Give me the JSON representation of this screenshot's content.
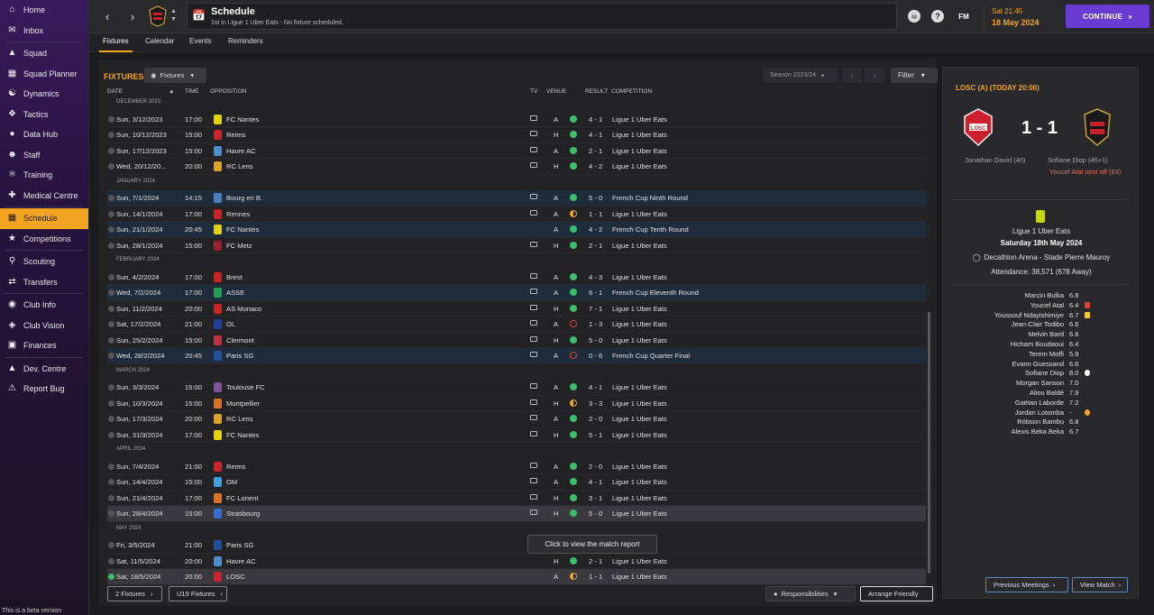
{
  "sidebar": {
    "items": [
      {
        "label": "Home",
        "icon": "home-icon"
      },
      {
        "label": "Inbox",
        "icon": "inbox-icon"
      },
      {
        "label": "Squad",
        "icon": "shirt-icon"
      },
      {
        "label": "Squad Planner",
        "icon": "planner-icon"
      },
      {
        "label": "Dynamics",
        "icon": "dynamics-icon"
      },
      {
        "label": "Tactics",
        "icon": "tactics-icon"
      },
      {
        "label": "Data Hub",
        "icon": "data-hub-icon"
      },
      {
        "label": "Staff",
        "icon": "staff-icon"
      },
      {
        "label": "Training",
        "icon": "training-icon"
      },
      {
        "label": "Medical Centre",
        "icon": "medical-icon"
      },
      {
        "label": "Schedule",
        "icon": "calendar-icon"
      },
      {
        "label": "Competitions",
        "icon": "trophy-icon"
      },
      {
        "label": "Scouting",
        "icon": "scouting-icon"
      },
      {
        "label": "Transfers",
        "icon": "transfers-icon"
      },
      {
        "label": "Club Info",
        "icon": "club-info-icon"
      },
      {
        "label": "Club Vision",
        "icon": "vision-icon"
      },
      {
        "label": "Finances",
        "icon": "finances-icon"
      },
      {
        "label": "Dev. Centre",
        "icon": "dev-centre-icon"
      },
      {
        "label": "Report Bug",
        "icon": "bug-icon"
      }
    ],
    "beta": "This is a beta version"
  },
  "header": {
    "title": "Schedule",
    "subtitle": "1st in Ligue 1 Uber Eats - No fixture scheduled.",
    "time": "Sat 21:45",
    "date": "18 May 2024",
    "continue": "CONTINUE",
    "fm": "FM"
  },
  "tabs": [
    "Fixtures",
    "Calendar",
    "Events",
    "Reminders"
  ],
  "main": {
    "heading": "FIXTURES",
    "fixtures_dd": "Fixtures",
    "season": "Season 2023/24",
    "filter": "Filter",
    "columns": {
      "date": "DATE",
      "time": "TIME",
      "opposition": "OPPOSITION",
      "tv": "TV",
      "venue": "VENUE",
      "result": "RESULT",
      "competition": "COMPETITION"
    },
    "tooltip": "Click to view the match report",
    "footer": {
      "fixtures2": "2 Fixtures",
      "u19": "U19 Fixtures",
      "responsibilities": "Responsibilities",
      "arrange": "Arrange Friendly"
    }
  },
  "rows": [
    {
      "m": "DECEMBER 2023"
    },
    {
      "d": "Sun, 3/12/2023",
      "t": "17:00",
      "o": "FC Nantes",
      "c": "#e6d200",
      "tv": 1,
      "v": "A",
      "r": "w",
      "s": "4 - 1",
      "comp": "Ligue 1 Uber Eats"
    },
    {
      "d": "Sun, 10/12/2023",
      "t": "15:00",
      "o": "Reims",
      "c": "#d0202a",
      "tv": 1,
      "v": "H",
      "r": "w",
      "s": "4 - 1",
      "comp": "Ligue 1 Uber Eats"
    },
    {
      "d": "Sun, 17/12/2023",
      "t": "15:00",
      "o": "Havre AC",
      "c": "#4a90d0",
      "tv": 1,
      "v": "A",
      "r": "w",
      "s": "2 - 1",
      "comp": "Ligue 1 Uber Eats"
    },
    {
      "d": "Wed, 20/12/20...",
      "t": "20:00",
      "o": "RC Lens",
      "c": "#e0a020",
      "tv": 1,
      "v": "H",
      "r": "w",
      "s": "4 - 2",
      "comp": "Ligue 1 Uber Eats"
    },
    {
      "m": "JANUARY 2024"
    },
    {
      "d": "Sun, 7/1/2024",
      "t": "14:15",
      "o": "Bourg en B.",
      "c": "#4a80c0",
      "tv": 1,
      "v": "A",
      "r": "w",
      "s": "5 - 0",
      "comp": "French Cup Ninth Round",
      "cup": 1
    },
    {
      "d": "Sun, 14/1/2024",
      "t": "17:00",
      "o": "Rennes",
      "c": "#d02020",
      "tv": 1,
      "v": "A",
      "r": "d",
      "s": "1 - 1",
      "comp": "Ligue 1 Uber Eats"
    },
    {
      "d": "Sun, 21/1/2024",
      "t": "20:45",
      "o": "FC Nantes",
      "c": "#e6d200",
      "tv": 0,
      "v": "A",
      "r": "w",
      "s": "4 - 2",
      "comp": "French Cup Tenth Round",
      "cup": 1
    },
    {
      "d": "Sun, 28/1/2024",
      "t": "15:00",
      "o": "FC Metz",
      "c": "#a02030",
      "tv": 1,
      "v": "H",
      "r": "w",
      "s": "2 - 1",
      "comp": "Ligue 1 Uber Eats"
    },
    {
      "m": "FEBRUARY 2024"
    },
    {
      "d": "Sun, 4/2/2024",
      "t": "17:00",
      "o": "Brest",
      "c": "#d02020",
      "tv": 1,
      "v": "A",
      "r": "w",
      "s": "4 - 3",
      "comp": "Ligue 1 Uber Eats"
    },
    {
      "d": "Wed, 7/2/2024",
      "t": "17:00",
      "o": "ASSE",
      "c": "#20a050",
      "tv": 1,
      "v": "A",
      "r": "w",
      "s": "6 - 1",
      "comp": "French Cup Eleventh Round",
      "cup": 1
    },
    {
      "d": "Sun, 11/2/2024",
      "t": "20:00",
      "o": "AS Monaco",
      "c": "#d02020",
      "tv": 1,
      "v": "H",
      "r": "w",
      "s": "7 - 1",
      "comp": "Ligue 1 Uber Eats"
    },
    {
      "d": "Sat, 17/2/2024",
      "t": "21:00",
      "o": "OL",
      "c": "#2040a0",
      "tv": 1,
      "v": "A",
      "r": "l",
      "s": "1 - 3",
      "comp": "Ligue 1 Uber Eats"
    },
    {
      "d": "Sun, 25/2/2024",
      "t": "15:00",
      "o": "Clermont",
      "c": "#c03040",
      "tv": 1,
      "v": "H",
      "r": "w",
      "s": "5 - 0",
      "comp": "Ligue 1 Uber Eats"
    },
    {
      "d": "Wed, 28/2/2024",
      "t": "20:45",
      "o": "Paris SG",
      "c": "#2050a0",
      "tv": 1,
      "v": "A",
      "r": "l",
      "s": "0 - 6",
      "comp": "French Cup Quarter Final",
      "cup": 1
    },
    {
      "m": "MARCH 2024"
    },
    {
      "d": "Sun, 3/3/2024",
      "t": "15:00",
      "o": "Toulouse FC",
      "c": "#8050a0",
      "tv": 1,
      "v": "A",
      "r": "w",
      "s": "4 - 1",
      "comp": "Ligue 1 Uber Eats"
    },
    {
      "d": "Sun, 10/3/2024",
      "t": "15:00",
      "o": "Montpellier",
      "c": "#e07020",
      "tv": 1,
      "v": "H",
      "r": "d",
      "s": "3 - 3",
      "comp": "Ligue 1 Uber Eats"
    },
    {
      "d": "Sun, 17/3/2024",
      "t": "20:00",
      "o": "RC Lens",
      "c": "#e0a020",
      "tv": 1,
      "v": "A",
      "r": "w",
      "s": "2 - 0",
      "comp": "Ligue 1 Uber Eats"
    },
    {
      "d": "Sun, 31/3/2024",
      "t": "17:00",
      "o": "FC Nantes",
      "c": "#e6d200",
      "tv": 1,
      "v": "H",
      "r": "w",
      "s": "5 - 1",
      "comp": "Ligue 1 Uber Eats"
    },
    {
      "m": "APRIL 2024"
    },
    {
      "d": "Sun, 7/4/2024",
      "t": "21:00",
      "o": "Reims",
      "c": "#d0202a",
      "tv": 1,
      "v": "A",
      "r": "w",
      "s": "2 - 0",
      "comp": "Ligue 1 Uber Eats"
    },
    {
      "d": "Sun, 14/4/2024",
      "t": "15:00",
      "o": "OM",
      "c": "#40a0e0",
      "tv": 1,
      "v": "A",
      "r": "w",
      "s": "4 - 1",
      "comp": "Ligue 1 Uber Eats"
    },
    {
      "d": "Sun, 21/4/2024",
      "t": "17:00",
      "o": "FC Lorient",
      "c": "#e07020",
      "tv": 1,
      "v": "H",
      "r": "w",
      "s": "3 - 1",
      "comp": "Ligue 1 Uber Eats"
    },
    {
      "d": "Sun, 28/4/2024",
      "t": "15:00",
      "o": "Strasbourg",
      "c": "#3070d0",
      "tv": 1,
      "v": "H",
      "r": "w",
      "s": "5 - 0",
      "comp": "Ligue 1 Uber Eats",
      "sel": 1
    },
    {
      "m": "MAY 2024"
    },
    {
      "d": "Fri, 3/5/2024",
      "t": "21:00",
      "o": "Paris SG",
      "c": "#2050a0",
      "tv": 0,
      "v": "",
      "r": "",
      "s": "",
      "comp": "Eats"
    },
    {
      "d": "Sat, 11/5/2024",
      "t": "20:00",
      "o": "Havre AC",
      "c": "#4a90d0",
      "tv": 0,
      "v": "H",
      "r": "w",
      "s": "2 - 1",
      "comp": "Ligue 1 Uber Eats"
    },
    {
      "d": "Sat, 18/5/2024",
      "t": "20:00",
      "o": "LOSC",
      "c": "#d02030",
      "tv": 0,
      "v": "A",
      "r": "d",
      "s": "1 - 1",
      "comp": "Ligue 1 Uber Eats",
      "sel": 1,
      "done": 1
    }
  ],
  "right": {
    "head": "LOSC (A) (TODAY 20:00)",
    "score": "1 - 1",
    "home_scorer": "Jonathan David (40)",
    "away_scorer": "Sofiane Diop (45+1)",
    "red": "Youcef Atal sent off (63)",
    "competition": "Ligue 1 Uber Eats",
    "date": "Saturday 18th May 2024",
    "venue": "Decathlon Arena - Stade Pierre Mauroy",
    "attendance": "Attendance: 38,571 (678 Away)",
    "players": [
      {
        "n": "Marcin Bulka",
        "r": "6.8",
        "e": ""
      },
      {
        "n": "Youcef Atal",
        "r": "6.4",
        "e": "red"
      },
      {
        "n": "Youssouf Ndayishimiye",
        "r": "6.7",
        "e": "yellow"
      },
      {
        "n": "Jean-Clair Todibo",
        "r": "6.6",
        "e": ""
      },
      {
        "n": "Melvin Bard",
        "r": "6.8",
        "e": ""
      },
      {
        "n": "Hicham Boudaoui",
        "r": "6.4",
        "e": ""
      },
      {
        "n": "Terem Moffi",
        "r": "5.9",
        "e": ""
      },
      {
        "n": "Evann Guessand",
        "r": "6.6",
        "e": ""
      },
      {
        "n": "Sofiane Diop",
        "r": "8.0",
        "e": "goal"
      },
      {
        "n": "Morgan Sanson",
        "r": "7.0",
        "e": ""
      },
      {
        "n": "Aliou Baldé",
        "r": "7.9",
        "e": ""
      },
      {
        "n": "Gaëtan Laborde",
        "r": "7.2",
        "e": ""
      },
      {
        "n": "Jordan Lotomba",
        "r": "-",
        "e": "sub"
      },
      {
        "n": "Róbson Bambu",
        "r": "6.8",
        "e": ""
      },
      {
        "n": "Alexis Beka Beka",
        "r": "6.7",
        "e": ""
      }
    ],
    "prev": "Previous Meetings",
    "view": "View Match"
  }
}
